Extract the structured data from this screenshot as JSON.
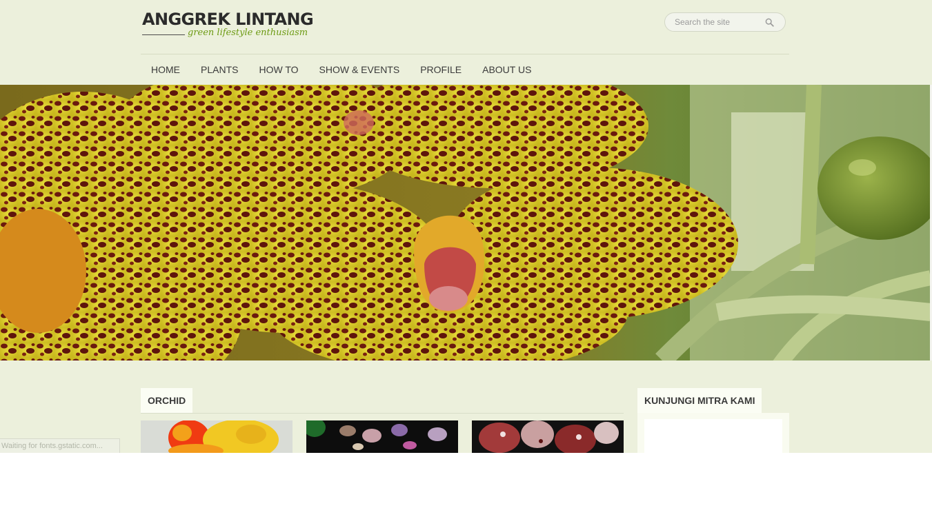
{
  "site": {
    "title": "ANGGREK LINTANG",
    "tagline": "green lifestyle enthusiasm"
  },
  "search": {
    "placeholder": "Search the site",
    "icon": "magnifier-icon"
  },
  "nav": {
    "items": [
      {
        "label": "HOME"
      },
      {
        "label": "PLANTS"
      },
      {
        "label": "HOW TO"
      },
      {
        "label": "SHOW & EVENTS"
      },
      {
        "label": "PROFILE"
      },
      {
        "label": "ABOUT US"
      }
    ]
  },
  "main": {
    "section_title": "ORCHID"
  },
  "sidebar": {
    "widget_title": "KUNJUNGI MITRA KAMI"
  },
  "status": {
    "text": "Waiting for fonts.gstatic.com..."
  },
  "colors": {
    "page_bg": "#ecf0dc",
    "accent_green": "#6c9a12",
    "text_dark": "#2b2b2b"
  }
}
